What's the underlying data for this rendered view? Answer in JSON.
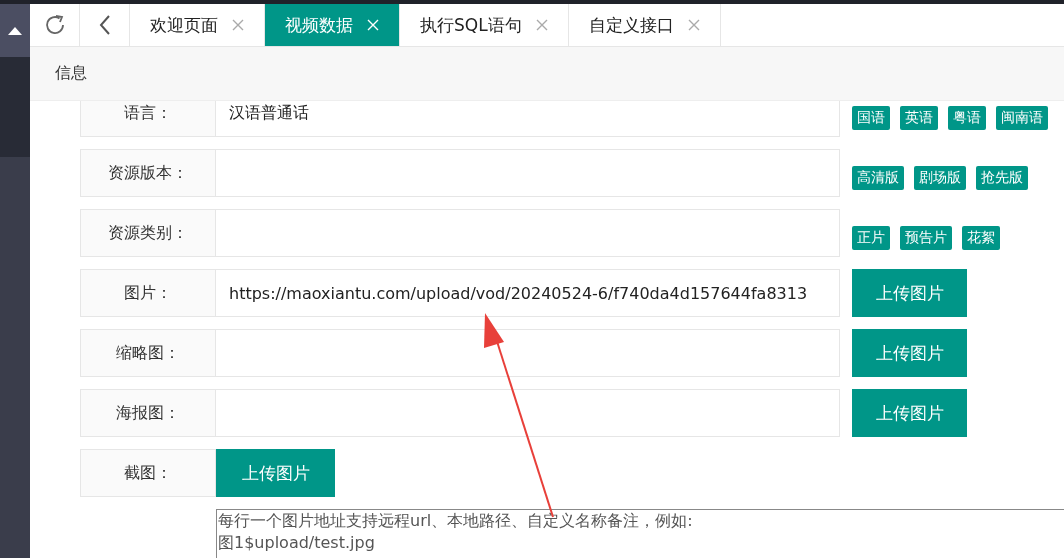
{
  "tabs": [
    {
      "label": "欢迎页面",
      "selected": false
    },
    {
      "label": "视频数据",
      "selected": true
    },
    {
      "label": "执行SQL语句",
      "selected": false
    },
    {
      "label": "自定义接口",
      "selected": false
    }
  ],
  "section_title": "信息",
  "form_rows": [
    {
      "kind": "tags",
      "label": "语言：",
      "value": "汉语普通话",
      "tags": [
        "国语",
        "英语",
        "粤语",
        "闽南语"
      ]
    },
    {
      "kind": "tags",
      "label": "资源版本：",
      "value": "",
      "tags": [
        "高清版",
        "剧场版",
        "抢先版"
      ]
    },
    {
      "kind": "tags",
      "label": "资源类别：",
      "value": "",
      "tags": [
        "正片",
        "预告片",
        "花絮"
      ]
    },
    {
      "kind": "upload",
      "label": "图片：",
      "value": "https://maoxiantu.com/upload/vod/20240524-6/f740da4d157644fa8313",
      "button": "上传图片"
    },
    {
      "kind": "upload",
      "label": "缩略图：",
      "value": "",
      "button": "上传图片"
    },
    {
      "kind": "upload",
      "label": "海报图：",
      "value": "",
      "button": "上传图片"
    },
    {
      "kind": "button",
      "label": "截图：",
      "button": "上传图片"
    }
  ],
  "screenshot_textarea": {
    "placeholder": "每行一个图片地址支持远程url、本地路径、自定义名称备注，例如:\n图1$upload/test.jpg"
  }
}
